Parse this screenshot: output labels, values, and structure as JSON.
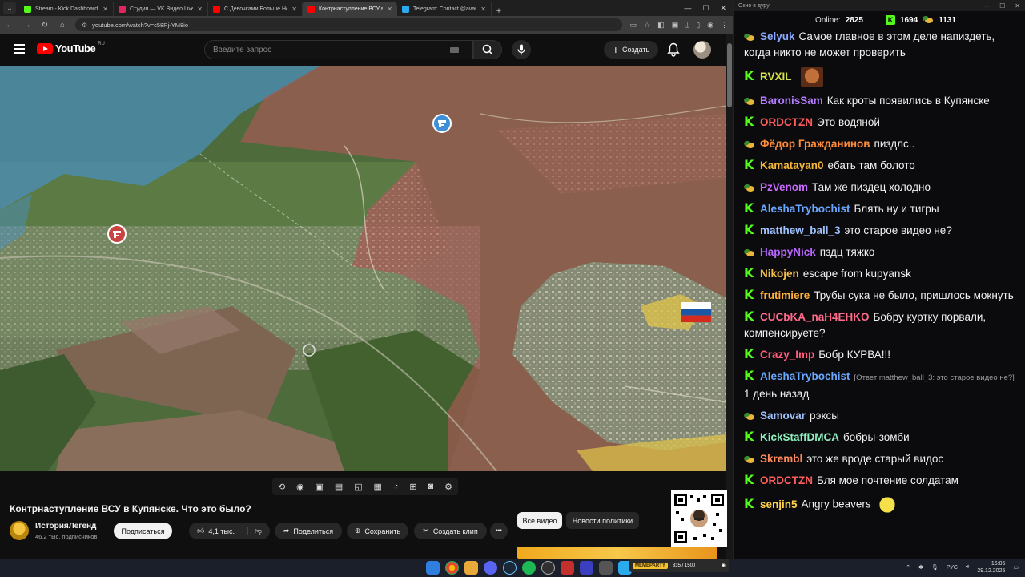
{
  "browser": {
    "tabs": [
      {
        "title": "Stream - Kick Dashboard",
        "color": "#53fc18",
        "active": false
      },
      {
        "title": "Студия — VK Видео Live",
        "color": "#e0245e",
        "active": false
      },
      {
        "title": "С Девочками Больше Не Хоч",
        "color": "#ff0000",
        "active": false
      },
      {
        "title": "Контрнаступление ВСУ в К",
        "color": "#ff0000",
        "active": true
      },
      {
        "title": "Telegram: Contact @avantonov",
        "color": "#2aabee",
        "active": false
      }
    ],
    "url": "youtube.com/watch?v=c58Rj-YM8io"
  },
  "youtube": {
    "logo_text": "YouTube",
    "region": "RU",
    "search_placeholder": "Введите запрос",
    "create_label": "Создать",
    "notifications_badge": "",
    "video": {
      "title": "Контрнаступление ВСУ в Купянске. Что это было?",
      "channel": "ИсторияЛегенд",
      "subscribers": "46,2 тыс. подписчиков",
      "subscribe_label": "Подписаться",
      "likes": "4,1 тыс.",
      "share_label": "Поделиться",
      "save_label": "Сохранить",
      "clip_label": "Создать клип",
      "more_label": "•••"
    },
    "chips": [
      "Все видео",
      "Новости политики"
    ]
  },
  "chat": {
    "window_title": "Окно в дуру",
    "online_label": "Online:",
    "online_count": "2825",
    "kick_count": "1694",
    "other_count": "1131",
    "messages": [
      {
        "platform": "other",
        "user": "Selyuk",
        "color": "#8aa9ff",
        "text": "Самое главное в этом деле напиздеть, когда никто не может проверить",
        "reply": "",
        "emote": ""
      },
      {
        "platform": "kick",
        "user": "RVXIL",
        "color": "#d6e04a",
        "text": "",
        "reply": "",
        "emote": "face"
      },
      {
        "platform": "other",
        "user": "BaronisSam",
        "color": "#b47cff",
        "text": "Как кроты появились в Купянске",
        "reply": "",
        "emote": ""
      },
      {
        "platform": "kick",
        "user": "ORDCTZN",
        "color": "#ff5c5c",
        "text": "Это водяной",
        "reply": "",
        "emote": ""
      },
      {
        "platform": "other",
        "user": "Фёдор Гражданинов",
        "color": "#ff8c3a",
        "text": "пиздлс..",
        "reply": "",
        "emote": ""
      },
      {
        "platform": "kick",
        "user": "Kamatayan0",
        "color": "#f4b63a",
        "text": "ебать там болото",
        "reply": "",
        "emote": ""
      },
      {
        "platform": "other",
        "user": "PzVenom",
        "color": "#c86bff",
        "text": "Там же пиздец холодно",
        "reply": "",
        "emote": ""
      },
      {
        "platform": "kick",
        "user": "AleshaTrybochist",
        "color": "#6aa7ff",
        "text": "Блять ну и тигры",
        "reply": "",
        "emote": ""
      },
      {
        "platform": "kick",
        "user": "matthew_ball_3",
        "color": "#9fc2ff",
        "text": "это старое видео не?",
        "reply": "",
        "emote": ""
      },
      {
        "platform": "other",
        "user": "HappyNick",
        "color": "#b766ff",
        "text": "пздц тяжко",
        "reply": "",
        "emote": ""
      },
      {
        "platform": "kick",
        "user": "Nikojen",
        "color": "#f4c04a",
        "text": "escape from kupyansk",
        "reply": "",
        "emote": ""
      },
      {
        "platform": "kick",
        "user": "frutimiere",
        "color": "#ffb13a",
        "text": "Трубы сука не было, пришлось мокнуть",
        "reply": "",
        "emote": ""
      },
      {
        "platform": "kick",
        "user": "CUCbKA_naH4EHKO",
        "color": "#ff6b8b",
        "text": "Бобру куртку порвали, компенсируете?",
        "reply": "",
        "emote": ""
      },
      {
        "platform": "kick",
        "user": "Crazy_Imp",
        "color": "#ff5c7a",
        "text": "Бобр КУРВА!!!",
        "reply": "",
        "emote": ""
      },
      {
        "platform": "kick",
        "user": "AleshaTrybochist",
        "color": "#6aa7ff",
        "text": "1 день назад",
        "reply": "[Ответ matthew_ball_3: это старое видео не?]",
        "emote": ""
      },
      {
        "platform": "other",
        "user": "Samovar",
        "color": "#9fc2ff",
        "text": "рэксы",
        "reply": "",
        "emote": ""
      },
      {
        "platform": "kick",
        "user": "KickStaffDMCA",
        "color": "#8ff0c0",
        "text": "бобры-зомби",
        "reply": "",
        "emote": ""
      },
      {
        "platform": "other",
        "user": "Skrembl",
        "color": "#ff8a5c",
        "text": "это же вроде старый видос",
        "reply": "",
        "emote": ""
      },
      {
        "platform": "kick",
        "user": "ORDCTZN",
        "color": "#ff5c5c",
        "text": "Бля мое почтение солдатам",
        "reply": "",
        "emote": ""
      },
      {
        "platform": "kick",
        "user": "senjin5",
        "color": "#ffd24a",
        "text": "Angry beavers",
        "reply": "",
        "emote": "beaver"
      }
    ]
  },
  "overlay": {
    "brand": "MEMEPARTY",
    "progress": "335 / 1500"
  },
  "taskbar": {
    "lang": "РУС",
    "time": "16:05",
    "date": "29.12.2025"
  }
}
